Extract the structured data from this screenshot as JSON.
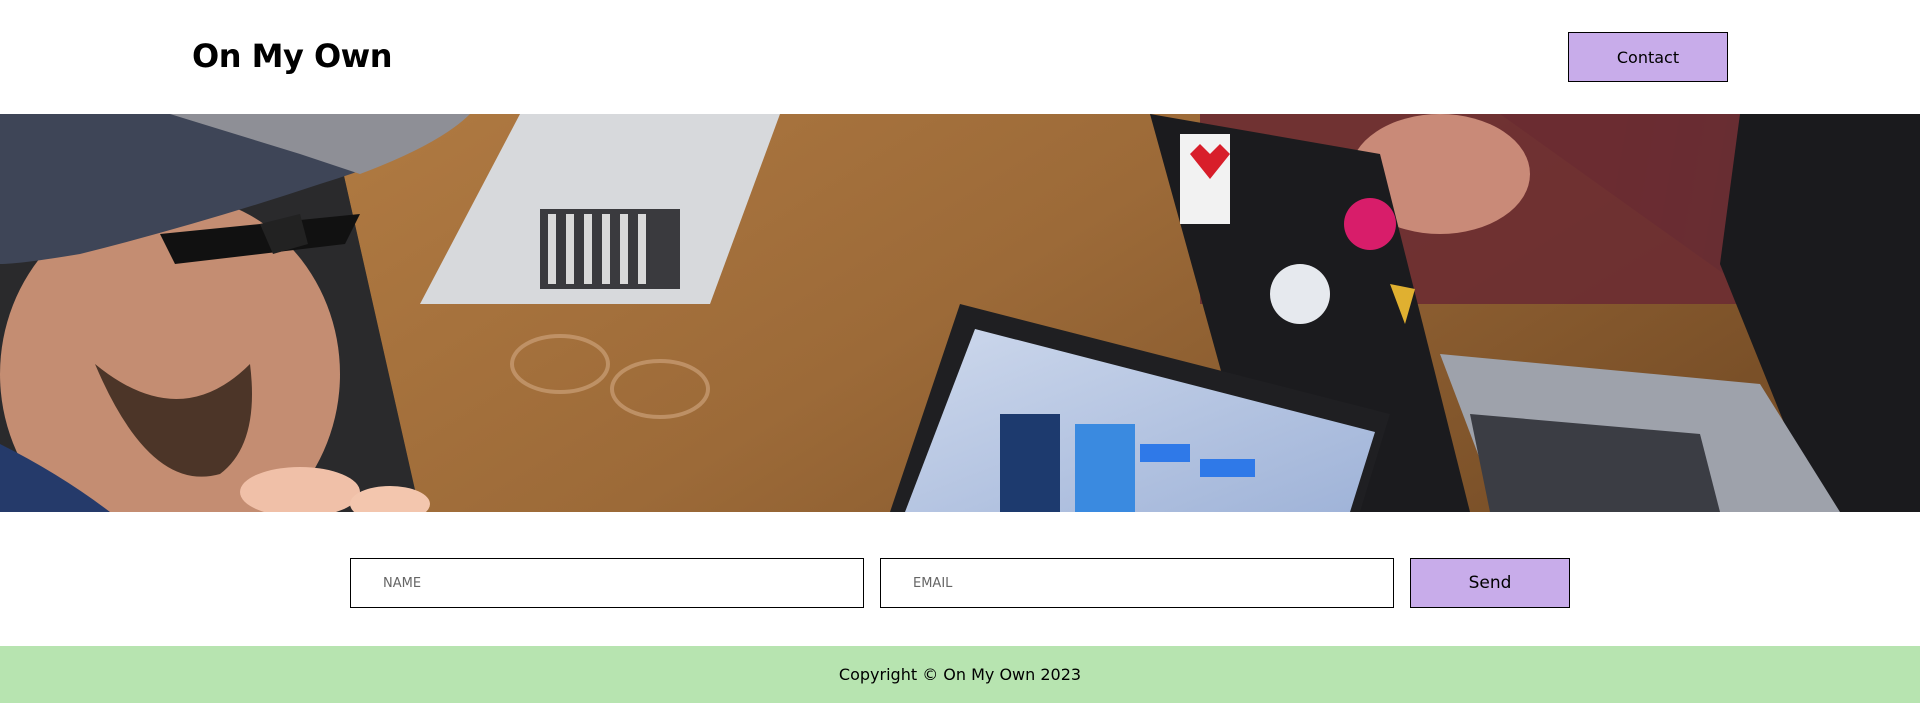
{
  "header": {
    "brand": "On My Own",
    "contact_label": "Contact"
  },
  "hero": {
    "description": "photo of people working at a wooden table with laptops"
  },
  "form": {
    "name_placeholder": "NAME",
    "email_placeholder": "EMAIL",
    "send_label": "Send"
  },
  "footer": {
    "copyright": "Copyright © On My Own 2023"
  },
  "colors": {
    "button_bg": "#c8acea",
    "footer_bg": "#b7e4b0",
    "border": "#000000"
  }
}
